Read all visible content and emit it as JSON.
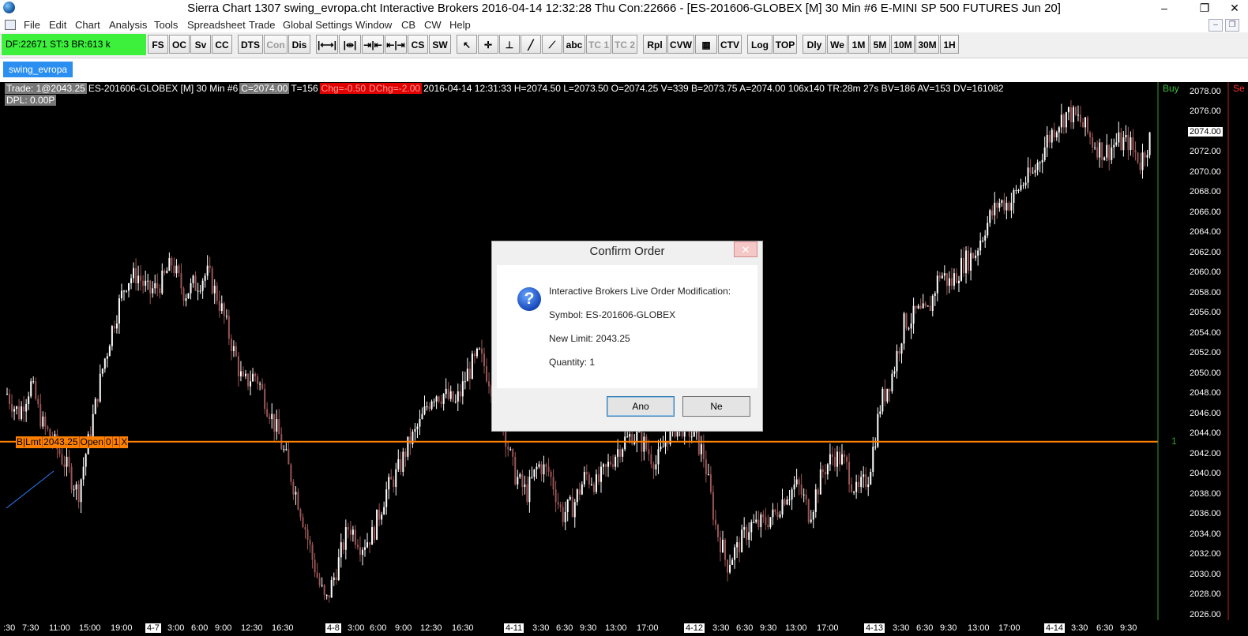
{
  "window": {
    "title": "Sierra Chart 1307 swing_evropa.cht  Interactive Brokers 2016-04-14  12:32:28 Thu  Con:22666 - [ES-201606-GLOBEX [M]  30 Min   #6  E-MINI SP 500 FUTURES Jun 20]",
    "minimize": "–",
    "restore": "❐",
    "close": "✕"
  },
  "menu": [
    "File",
    "Edit",
    "Chart",
    "Analysis",
    "Tools",
    "Spreadsheet",
    "Trade",
    "Global Settings",
    "Window",
    "CB",
    "CW",
    "Help"
  ],
  "status": "DF:22671  ST:3  BR:613 k",
  "toolbar": [
    {
      "label": "FS"
    },
    {
      "label": "OC"
    },
    {
      "label": "Sv"
    },
    {
      "label": "CC"
    },
    {
      "label": "DTS"
    },
    {
      "label": "Con",
      "disabled": true
    },
    {
      "label": "Dis"
    },
    {
      "label": "|⟷|",
      "icon": "zoom-out-icon"
    },
    {
      "label": "|⇹|",
      "icon": "zoom-in-icon"
    },
    {
      "label": "⇥|⇤",
      "icon": "compress-icon"
    },
    {
      "label": "⇤|⇥",
      "icon": "expand-icon"
    },
    {
      "label": "CS"
    },
    {
      "label": "SW"
    },
    {
      "label": "↖",
      "icon": "pointer-icon"
    },
    {
      "label": "✛",
      "icon": "crosshair-icon"
    },
    {
      "label": "⊥",
      "icon": "cursor-line-icon"
    },
    {
      "label": "╱",
      "icon": "line-tool-icon"
    },
    {
      "label": "⟋",
      "icon": "ray-tool-icon"
    },
    {
      "label": "abc"
    },
    {
      "label": "TC 1",
      "disabled": true
    },
    {
      "label": "TC 2",
      "disabled": true
    },
    {
      "label": "Rpl"
    },
    {
      "label": "CVW"
    },
    {
      "label": "▦",
      "icon": "dom-icon"
    },
    {
      "label": "CTV"
    },
    {
      "label": "Log"
    },
    {
      "label": "TOP"
    },
    {
      "label": "Dly"
    },
    {
      "label": "We"
    },
    {
      "label": "1M"
    },
    {
      "label": "5M"
    },
    {
      "label": "10M"
    },
    {
      "label": "30M"
    },
    {
      "label": "1H"
    }
  ],
  "tab": "swing_evropa",
  "chart_info": {
    "trade": "Trade: 1@2043.25",
    "symbol": "ES-201606-GLOBEX [M]  30 Min   #6",
    "close": "C=2074.00",
    "ticks": "T=156",
    "chg": "Chg=-0.50",
    "dchg": "DChg=-2.00",
    "rest": "2016-04-14 12:31:33  H=2074.50  L=2073.50  O=2074.25  V=339  B=2073.75  A=2074.00  106x140  TR:28m 27s  BV=186  AV=153  DV=161082",
    "dpl": "DPL: 0.00P",
    "buy": "Buy",
    "sell": "Se"
  },
  "order": {
    "fields": [
      "B|Lmt",
      "2043.25",
      "Open",
      "0",
      "1",
      "X"
    ],
    "qty": "1",
    "price": 2043.25,
    "color": "#ff8000"
  },
  "y_axis": [
    "2078.00",
    "2076.00",
    "2074.00",
    "2072.00",
    "2070.00",
    "2068.00",
    "2066.00",
    "2064.00",
    "2062.00",
    "2060.00",
    "2058.00",
    "2056.00",
    "2054.00",
    "2052.00",
    "2050.00",
    "2048.00",
    "2046.00",
    "2044.00",
    "2042.00",
    "2040.00",
    "2038.00",
    "2036.00",
    "2034.00",
    "2032.00",
    "2030.00",
    "2028.00",
    "2026.00"
  ],
  "current_price": "2074.00",
  "x_axis": [
    {
      "t": ":30"
    },
    {
      "t": "7:30"
    },
    {
      "t": "11:00"
    },
    {
      "t": "15:00"
    },
    {
      "t": "19:00"
    },
    {
      "t": "4-7",
      "day": true
    },
    {
      "t": "3:00"
    },
    {
      "t": "6:00"
    },
    {
      "t": "9:00"
    },
    {
      "t": "12:30"
    },
    {
      "t": "16:30"
    },
    {
      "t": "4-8",
      "day": true
    },
    {
      "t": "3:00"
    },
    {
      "t": "6:00"
    },
    {
      "t": "9:00"
    },
    {
      "t": "12:30"
    },
    {
      "t": "16:30"
    },
    {
      "t": "4-11",
      "day": true
    },
    {
      "t": "3:30"
    },
    {
      "t": "6:30"
    },
    {
      "t": "9:30"
    },
    {
      "t": "13:00"
    },
    {
      "t": "17:00"
    },
    {
      "t": "4-12",
      "day": true
    },
    {
      "t": "3:30"
    },
    {
      "t": "6:30"
    },
    {
      "t": "9:30"
    },
    {
      "t": "13:00"
    },
    {
      "t": "17:00"
    },
    {
      "t": "4-13",
      "day": true
    },
    {
      "t": "3:30"
    },
    {
      "t": "6:30"
    },
    {
      "t": "9:30"
    },
    {
      "t": "13:00"
    },
    {
      "t": "17:00"
    },
    {
      "t": "4-14",
      "day": true
    },
    {
      "t": "3:30"
    },
    {
      "t": "6:30"
    },
    {
      "t": "9:30"
    }
  ],
  "dialog": {
    "title": "Confirm Order",
    "close": "✕",
    "icon": "question-icon",
    "lines": [
      "Interactive Brokers Live Order Modification:",
      "Symbol: ES-201606-GLOBEX",
      "New Limit: 2043.25",
      "Quantity: 1"
    ],
    "ok": "Ano",
    "cancel": "Ne"
  },
  "chart_data": {
    "type": "candlestick",
    "y_range": [
      2025.5,
      2079
    ],
    "up_color": "#ffffff",
    "down_color": "#9a5555",
    "close_path": [
      2048,
      2046,
      2049,
      2045,
      2043,
      2041,
      2038,
      2044,
      2050,
      2055,
      2059,
      2060,
      2058,
      2059,
      2061,
      2058,
      2059,
      2060,
      2057,
      2053,
      2049,
      2050,
      2047,
      2044,
      2040,
      2036,
      2031,
      2027,
      2031,
      2035,
      2033,
      2034,
      2038,
      2040,
      2043,
      2045,
      2048,
      2048,
      2047,
      2050,
      2052,
      2049,
      2045,
      2040,
      2038,
      2041,
      2040,
      2036,
      2037,
      2040,
      2039,
      2041,
      2043,
      2044,
      2043,
      2041,
      2044,
      2045,
      2044,
      2042,
      2035,
      2031,
      2033,
      2035,
      2035,
      2036,
      2038,
      2039,
      2036,
      2040,
      2042,
      2041,
      2038,
      2040,
      2047,
      2050,
      2055,
      2056,
      2056,
      2060,
      2059,
      2061,
      2062,
      2065,
      2067,
      2067,
      2069,
      2070,
      2073,
      2075,
      2076,
      2075,
      2073,
      2072,
      2073,
      2073,
      2071,
      2074
    ]
  }
}
